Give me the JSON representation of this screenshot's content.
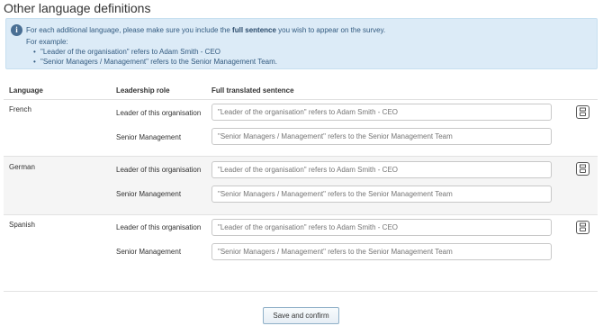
{
  "page": {
    "title": "Other language definitions"
  },
  "info": {
    "icon": "info-icon",
    "line1_pre": "For each additional language, please make sure you include the ",
    "line1_bold": "full sentence",
    "line1_post": " you wish to appear on the survey.",
    "line2": "For example:",
    "examples": [
      "\"Leader of the organisation\" refers to Adam Smith - CEO",
      "\"Senior Managers / Management\" refers to the Senior Management Team."
    ]
  },
  "table": {
    "headers": {
      "language": "Language",
      "role": "Leadership role",
      "sentence": "Full translated sentence"
    },
    "groups": [
      {
        "language": "French",
        "rows": [
          {
            "role": "Leader of this organisation",
            "placeholder": "\"Leader of the organisation\" refers to Adam Smith - CEO",
            "value": ""
          },
          {
            "role": "Senior Management",
            "placeholder": "\"Senior Managers / Management\" refers to the Senior Management Team",
            "value": ""
          }
        ]
      },
      {
        "language": "German",
        "rows": [
          {
            "role": "Leader of this organisation",
            "placeholder": "\"Leader of the organisation\" refers to Adam Smith - CEO",
            "value": ""
          },
          {
            "role": "Senior Management",
            "placeholder": "\"Senior Managers / Management\" refers to the Senior Management Team",
            "value": ""
          }
        ]
      },
      {
        "language": "Spanish",
        "rows": [
          {
            "role": "Leader of this organisation",
            "placeholder": "\"Leader of the organisation\" refers to Adam Smith - CEO",
            "value": ""
          },
          {
            "role": "Senior Management",
            "placeholder": "\"Senior Managers / Management\" refers to the Senior Management Team",
            "value": ""
          }
        ]
      }
    ],
    "save_icon": "save-icon"
  },
  "footer": {
    "confirm_label": "Save and confirm"
  },
  "colors": {
    "info_bg": "#dcebf7",
    "info_text": "#335b80",
    "shaded_row": "#f5f5f5",
    "button_border": "#8fb0c8"
  }
}
